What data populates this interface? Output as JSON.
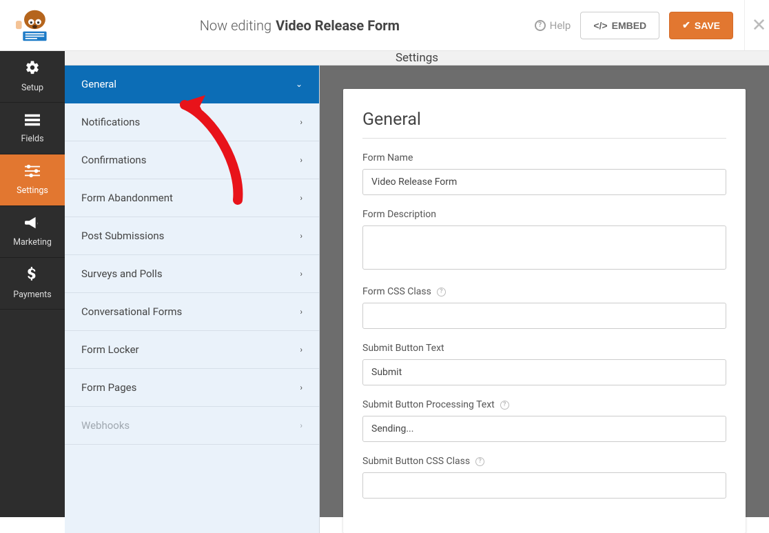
{
  "header": {
    "now_editing_label": "Now editing",
    "form_title": "Video Release Form",
    "help_label": "Help",
    "embed_label": "EMBED",
    "save_label": "SAVE"
  },
  "left_nav": {
    "items": [
      {
        "label": "Setup"
      },
      {
        "label": "Fields"
      },
      {
        "label": "Settings"
      },
      {
        "label": "Marketing"
      },
      {
        "label": "Payments"
      }
    ]
  },
  "settings_header": "Settings",
  "settings_list": {
    "items": [
      {
        "label": "General",
        "active": true
      },
      {
        "label": "Notifications"
      },
      {
        "label": "Confirmations"
      },
      {
        "label": "Form Abandonment"
      },
      {
        "label": "Post Submissions"
      },
      {
        "label": "Surveys and Polls"
      },
      {
        "label": "Conversational Forms"
      },
      {
        "label": "Form Locker"
      },
      {
        "label": "Form Pages"
      },
      {
        "label": "Webhooks",
        "disabled": true
      }
    ]
  },
  "panel": {
    "title": "General",
    "fields": {
      "form_name": {
        "label": "Form Name",
        "value": "Video Release Form"
      },
      "form_description": {
        "label": "Form Description",
        "value": ""
      },
      "form_css_class": {
        "label": "Form CSS Class",
        "value": ""
      },
      "submit_button_text": {
        "label": "Submit Button Text",
        "value": "Submit"
      },
      "submit_button_processing": {
        "label": "Submit Button Processing Text",
        "value": "Sending..."
      },
      "submit_button_css_class": {
        "label": "Submit Button CSS Class",
        "value": ""
      }
    }
  },
  "colors": {
    "accent_orange": "#e27730",
    "accent_blue": "#0c6db6",
    "panel_bg": "#eaf2fa"
  }
}
